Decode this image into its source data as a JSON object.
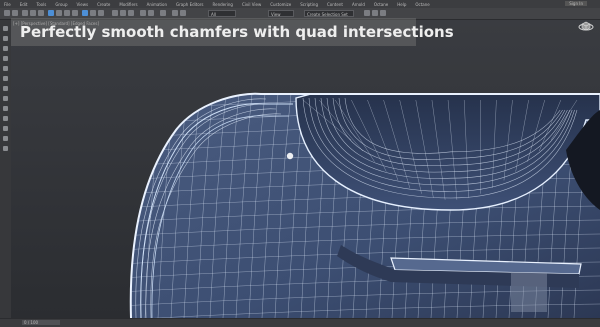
{
  "menu": {
    "items": [
      "File",
      "Edit",
      "Tools",
      "Group",
      "Views",
      "Create",
      "Modifiers",
      "Animation",
      "Graph Editors",
      "Rendering",
      "Civil View",
      "Customize",
      "Scripting",
      "Content",
      "Arnold",
      "Octane",
      "Help",
      "Octane"
    ],
    "account_label": "Sign In"
  },
  "toolbar": {
    "selection_filter": "All",
    "view_dropdown": "View",
    "named_selection_placeholder": "Create Selection Set",
    "icons": [
      "undo-icon",
      "redo-icon",
      "link-icon",
      "unlink-icon",
      "bind-icon",
      "select-icon",
      "select-by-name-icon",
      "rect-select-icon",
      "window-crossing-icon",
      "move-icon",
      "rotate-icon",
      "scale-icon",
      "snaps-icon",
      "angle-snap-icon",
      "percent-snap-icon",
      "mirror-icon",
      "align-icon",
      "layer-icon",
      "curve-editor-icon",
      "material-editor-icon",
      "render-setup-icon",
      "render-frame-icon",
      "render-icon"
    ]
  },
  "viewport": {
    "label": "[+] [Perspective] [Standard] [Edged Faces]",
    "caption": "Perfectly smooth chamfers with quad intersections"
  },
  "colors": {
    "wire": "#e6f0ff",
    "mesh_fill": "#3c4e72",
    "mesh_shadow": "#25304a",
    "background_top": "#3a3c41",
    "background_bottom": "#2b2d31",
    "caption_bg": "#8c8c8c",
    "accent_blue": "#4d8fd6"
  },
  "statusbar": {
    "frame_counter": "0 / 100"
  }
}
